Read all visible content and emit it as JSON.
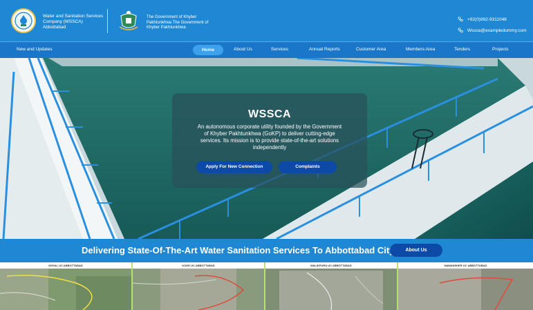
{
  "header": {
    "org_name": "Water and Sanitation Services Company (WSSCA) Abbottabad",
    "gov_name": "The Government of Khyber Pakhtunkhwa The Government of Khyber Pakhtunkhwa",
    "phone": "+92(0)992-9311048",
    "email": "Wssca@exampledummy.com"
  },
  "nav": {
    "news": "New and Updates",
    "items": [
      {
        "label": "Home",
        "active": true
      },
      {
        "label": "About Us"
      },
      {
        "label": "Services"
      },
      {
        "label": "Annual Reports"
      },
      {
        "label": "Customer Area"
      },
      {
        "label": "Members Area"
      },
      {
        "label": "Tenders"
      },
      {
        "label": "Projects"
      }
    ]
  },
  "hero": {
    "title": "WSSCA",
    "description": "An autonomous corporate utility founded by the Government of Khyber Pakhtunkhwa (GoKP) to deliver cutting-edge services. Its mission is to provide state-of-the-art solutions independently",
    "apply_label": "Apply For New Connection",
    "complaints_label": "Complaints"
  },
  "banner": {
    "text": "Delivering State-Of-The-Art Water Sanitation Services To Abbottabad City",
    "about_label": "About Us"
  },
  "maps": [
    {
      "title": "KEHAL UC ABBOTTABAD"
    },
    {
      "title": "KOKE UC ABBOTTABAD"
    },
    {
      "title": "MALIKPURA UC ABBOTTABAD"
    },
    {
      "title": "NAWANSHER UC ABBOTTABAD"
    }
  ],
  "colors": {
    "header_blue": "#1e88d4",
    "nav_blue": "#1976c8",
    "button_navy": "#0d4aa8",
    "water_teal": "#1f6e6a"
  }
}
